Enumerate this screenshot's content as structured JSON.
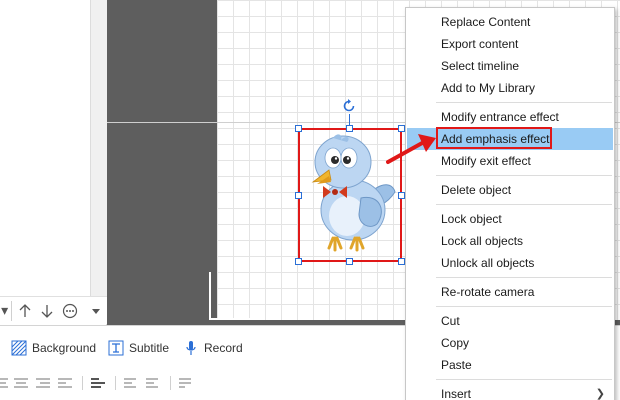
{
  "context_menu": {
    "items": [
      {
        "label": "Replace Content"
      },
      {
        "label": "Export content"
      },
      {
        "label": "Select timeline"
      },
      {
        "label": "Add to My Library"
      },
      {
        "label": "Modify entrance effect"
      },
      {
        "label": "Add emphasis effect",
        "highlighted": true
      },
      {
        "label": "Modify exit effect"
      },
      {
        "label": "Delete object"
      },
      {
        "label": "Lock object"
      },
      {
        "label": "Lock all objects"
      },
      {
        "label": "Unlock all objects"
      },
      {
        "label": "Re-rotate camera"
      },
      {
        "label": "Cut"
      },
      {
        "label": "Copy"
      },
      {
        "label": "Paste"
      },
      {
        "label": "Insert",
        "has_submenu": true
      }
    ]
  },
  "bottom_toolbar": {
    "background_label": "Background",
    "subtitle_label": "Subtitle",
    "record_label": "Record"
  },
  "icons": {
    "vertical_toolbar": [
      "up-arrow-icon",
      "down-arrow-icon",
      "more-icon",
      "dropdown-icon"
    ],
    "rotate": "rotate-icon",
    "submenu": "chevron-right-icon"
  },
  "colors": {
    "highlight_row": "#99cbf4",
    "annotation_red": "#e01818",
    "handle_blue": "#2b6fd6",
    "canvas_dark": "#5e5e5e"
  }
}
